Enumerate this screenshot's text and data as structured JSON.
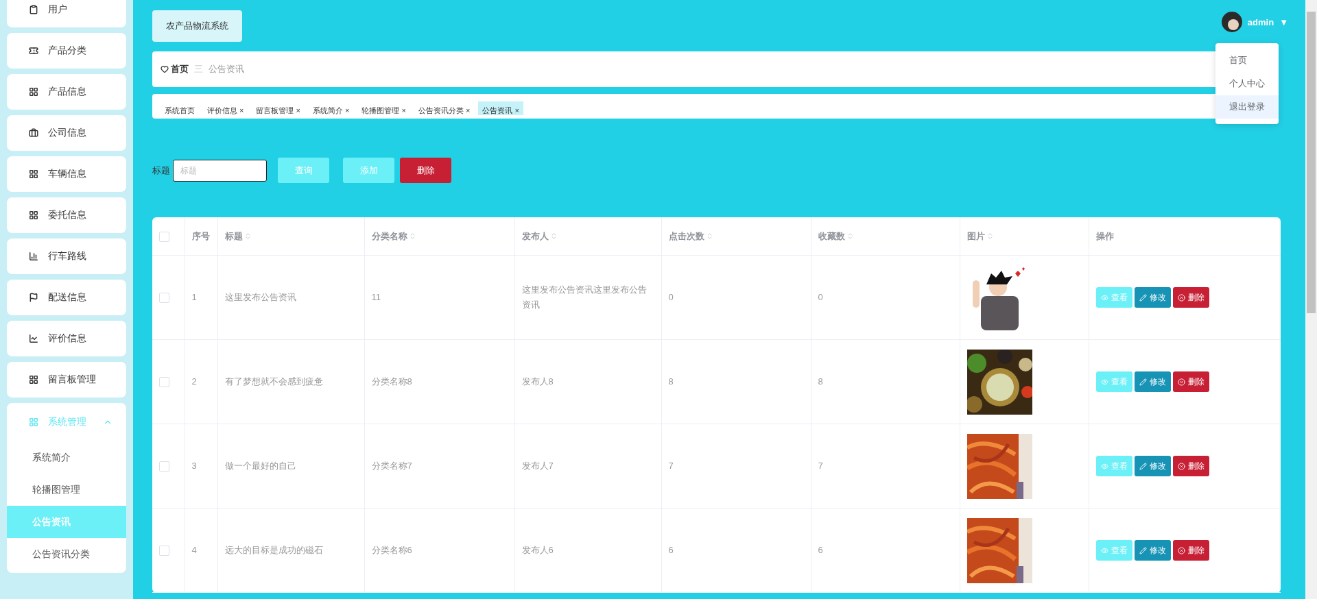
{
  "sidebar": {
    "items": [
      {
        "label": "用户",
        "selected": false
      },
      {
        "label": "产品分类",
        "selected": false
      },
      {
        "label": "产品信息",
        "selected": false
      },
      {
        "label": "公司信息",
        "selected": false
      },
      {
        "label": "车辆信息",
        "selected": false
      },
      {
        "label": "委托信息",
        "selected": false
      },
      {
        "label": "行车路线",
        "selected": false
      },
      {
        "label": "配送信息",
        "selected": false
      },
      {
        "label": "评价信息",
        "selected": false
      },
      {
        "label": "留言板管理",
        "selected": false
      }
    ],
    "group": {
      "label": "系统管理",
      "expanded": true,
      "children": [
        {
          "label": "系统简介",
          "selected": false
        },
        {
          "label": "轮播图管理",
          "selected": false
        },
        {
          "label": "公告资讯",
          "selected": true
        },
        {
          "label": "公告资讯分类",
          "selected": false
        }
      ]
    }
  },
  "header": {
    "system_title": "农产品物流系统",
    "user": {
      "name": "admin",
      "caret": "▼"
    },
    "user_menu": [
      {
        "label": "首页",
        "highlighted": false
      },
      {
        "label": "个人中心",
        "highlighted": false
      },
      {
        "label": "退出登录",
        "highlighted": true
      }
    ]
  },
  "breadcrumb": {
    "home": "首页",
    "separator": "三",
    "current": "公告资讯"
  },
  "tabs": [
    {
      "label": "系统首页",
      "selected": false
    },
    {
      "label": "评价信息",
      "close": "×",
      "selected": false
    },
    {
      "label": "留言板管理",
      "close": "×",
      "selected": false
    },
    {
      "label": "系统简介",
      "close": "×",
      "selected": false
    },
    {
      "label": "轮播图管理",
      "close": "×",
      "selected": false
    },
    {
      "label": "公告资讯分类",
      "close": "×",
      "selected": false
    },
    {
      "label": "公告资讯",
      "close": "×",
      "selected": true
    }
  ],
  "search": {
    "label": "标题",
    "placeholder": "标题"
  },
  "buttons": [
    {
      "label": "查询",
      "kind": "search"
    },
    {
      "label": "添加",
      "kind": "add"
    },
    {
      "label": "删除",
      "kind": "delete"
    }
  ],
  "table": {
    "select_all": {
      "checked": false
    },
    "columns": [
      {
        "label": "序号",
        "sortable": false
      },
      {
        "label": "标题",
        "sortable": true
      },
      {
        "label": "分类名称",
        "sortable": true
      },
      {
        "label": "发布人",
        "sortable": true
      },
      {
        "label": "点击次数",
        "sortable": true
      },
      {
        "label": "收藏数",
        "sortable": true
      },
      {
        "label": "图片",
        "sortable": true
      },
      {
        "label": "操作",
        "sortable": false
      }
    ],
    "rows": [
      {
        "checked": false,
        "cells": [
          "1",
          "这里发布公告资讯",
          "11",
          "这里发布公告资讯这里发布公告资讯",
          "0",
          "0"
        ],
        "image": {
          "kind": "picture"
        },
        "actions": [
          {
            "label": "查看",
            "kind": "view"
          },
          {
            "label": "修改",
            "kind": "edit"
          },
          {
            "label": "删除",
            "kind": "delete"
          }
        ]
      },
      {
        "checked": false,
        "cells": [
          "2",
          "有了梦想就不会感到疲惫",
          "分类名称8",
          "发布人8",
          "8",
          "8"
        ],
        "image": {
          "kind": "picture"
        },
        "actions": [
          {
            "label": "查看",
            "kind": "view"
          },
          {
            "label": "修改",
            "kind": "edit"
          },
          {
            "label": "删除",
            "kind": "delete"
          }
        ]
      },
      {
        "checked": false,
        "cells": [
          "3",
          "做一个最好的自己",
          "分类名称7",
          "发布人7",
          "7",
          "7"
        ],
        "image": {
          "kind": "picture"
        },
        "actions": [
          {
            "label": "查看",
            "kind": "view"
          },
          {
            "label": "修改",
            "kind": "edit"
          },
          {
            "label": "删除",
            "kind": "delete"
          }
        ]
      },
      {
        "checked": false,
        "cells": [
          "4",
          "远大的目标是成功的磁石",
          "分类名称6",
          "发布人6",
          "6",
          "6"
        ],
        "image": {
          "kind": "picture"
        },
        "actions": [
          {
            "label": "查看",
            "kind": "view"
          },
          {
            "label": "修改",
            "kind": "edit"
          },
          {
            "label": "删除",
            "kind": "delete"
          }
        ]
      }
    ]
  }
}
